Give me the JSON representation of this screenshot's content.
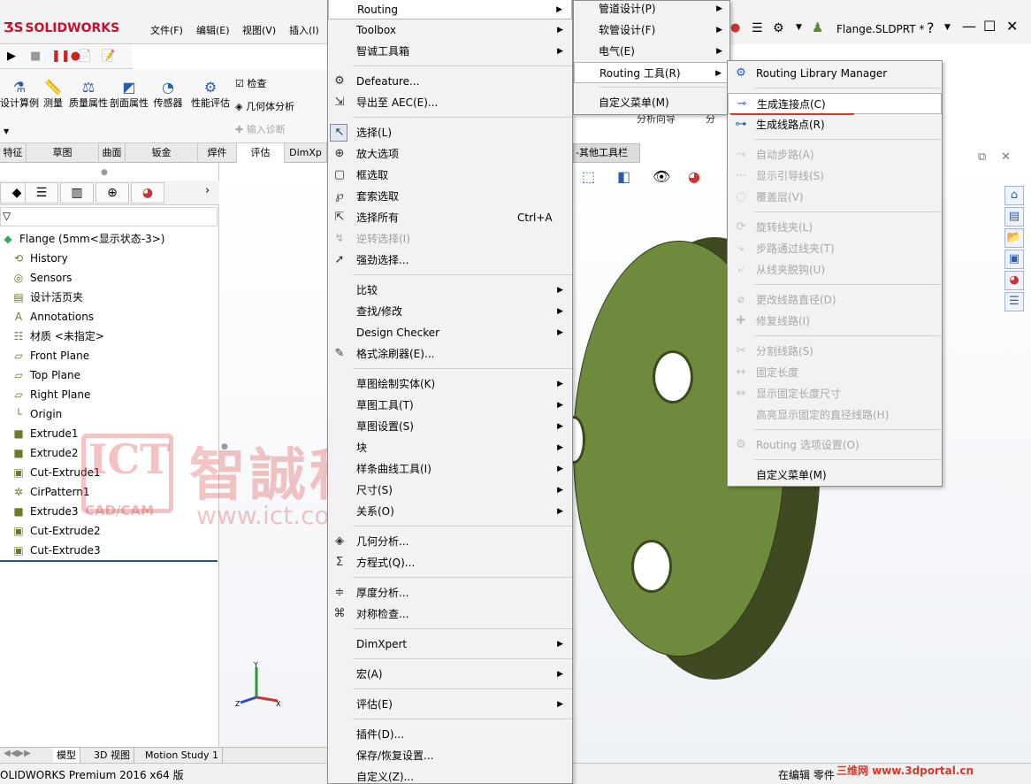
{
  "app": {
    "logo": "SOLIDWORKS",
    "menus": [
      "文件(F)",
      "编辑(E)",
      "视图(V)",
      "插入(I)"
    ],
    "doc_title": "Flange.SLDPRT *",
    "help": "?"
  },
  "command_manager": {
    "buttons": [
      "设计算例",
      "测量",
      "质量属性",
      "剖面属性",
      "传感器",
      "性能评估"
    ],
    "right_items": [
      "检查",
      "几何体分析",
      "输入诊断"
    ],
    "tabs": [
      "特征",
      "草图",
      "曲面",
      "钣金",
      "焊件",
      "评估",
      "DimXp"
    ],
    "active_tab": "评估",
    "partial_labels": [
      "分析向导",
      "分"
    ],
    "other_toolbar": "-其他工具栏"
  },
  "feature_tree": {
    "root": "Flange  (5mm<显示状态-3>)",
    "items": [
      {
        "label": "History",
        "icon": "history-icon"
      },
      {
        "label": "Sensors",
        "icon": "sensor-icon"
      },
      {
        "label": "设计活页夹",
        "icon": "binder-icon"
      },
      {
        "label": "Annotations",
        "icon": "annotation-icon"
      },
      {
        "label": "材质 <未指定>",
        "icon": "material-icon"
      },
      {
        "label": "Front Plane",
        "icon": "plane-icon"
      },
      {
        "label": "Top Plane",
        "icon": "plane-icon"
      },
      {
        "label": "Right Plane",
        "icon": "plane-icon"
      },
      {
        "label": "Origin",
        "icon": "origin-icon"
      },
      {
        "label": "Extrude1",
        "icon": "extrude-icon"
      },
      {
        "label": "Extrude2",
        "icon": "extrude-icon"
      },
      {
        "label": "Cut-Extrude1",
        "icon": "cut-icon"
      },
      {
        "label": "CirPattern1",
        "icon": "pattern-icon"
      },
      {
        "label": "Extrude3",
        "icon": "extrude-icon"
      },
      {
        "label": "Cut-Extrude2",
        "icon": "cut-icon"
      },
      {
        "label": "Cut-Extrude3",
        "icon": "cut-icon"
      }
    ]
  },
  "bottom_tabs": [
    "模型",
    "3D 视图",
    "Motion Study 1"
  ],
  "status": {
    "left": "OLIDWORKS Premium 2016 x64 版",
    "right": "在编辑 零件"
  },
  "context_menu": {
    "items": [
      {
        "label": "Routing",
        "arrow": true,
        "highlight": true
      },
      {
        "label": "Toolbox",
        "arrow": true
      },
      {
        "label": "智诚工具箱",
        "arrow": true
      },
      {
        "sep": true
      },
      {
        "label": "Defeature...",
        "icon": "defeature-icon"
      },
      {
        "label": "导出至 AEC(E)...",
        "icon": "export-icon"
      },
      {
        "sep": true
      },
      {
        "label": "选择(L)",
        "icon": "cursor-icon",
        "boxed": true
      },
      {
        "label": "放大选项",
        "icon": "magnify-icon"
      },
      {
        "label": "框选取",
        "icon": "box-select-icon"
      },
      {
        "label": "套索选取",
        "icon": "lasso-icon"
      },
      {
        "label": "选择所有",
        "icon": "select-all-icon",
        "shortcut": "Ctrl+A"
      },
      {
        "label": "逆转选择(I)",
        "icon": "invert-select-icon",
        "disabled": true
      },
      {
        "label": "强劲选择...",
        "icon": "power-select-icon"
      },
      {
        "sep": true
      },
      {
        "label": "比较",
        "arrow": true
      },
      {
        "label": "查找/修改",
        "arrow": true
      },
      {
        "label": "Design Checker",
        "arrow": true
      },
      {
        "label": "格式涂刷器(E)...",
        "icon": "format-painter-icon"
      },
      {
        "sep": true
      },
      {
        "label": "草图绘制实体(K)",
        "arrow": true
      },
      {
        "label": "草图工具(T)",
        "arrow": true
      },
      {
        "label": "草图设置(S)",
        "arrow": true
      },
      {
        "label": "块",
        "arrow": true
      },
      {
        "label": "样条曲线工具(I)",
        "arrow": true
      },
      {
        "label": "尺寸(S)",
        "arrow": true
      },
      {
        "label": "关系(O)",
        "arrow": true
      },
      {
        "sep": true
      },
      {
        "label": "几何分析...",
        "icon": "geometry-analysis-icon"
      },
      {
        "label": "方程式(Q)...",
        "icon": "sigma-icon"
      },
      {
        "sep": true
      },
      {
        "label": "厚度分析...",
        "icon": "thickness-icon"
      },
      {
        "label": "对称检查...",
        "icon": "symmetry-icon"
      },
      {
        "sep": true
      },
      {
        "label": "DimXpert",
        "arrow": true
      },
      {
        "sep": true
      },
      {
        "label": "宏(A)",
        "arrow": true
      },
      {
        "sep": true
      },
      {
        "label": "评估(E)",
        "arrow": true
      },
      {
        "sep": true
      },
      {
        "label": "插件(D)..."
      },
      {
        "label": "保存/恢复设置..."
      },
      {
        "label": "自定义(Z)..."
      }
    ]
  },
  "submenu_routing": {
    "items": [
      {
        "label": "管道设计(P)",
        "arrow": true
      },
      {
        "label": "软管设计(F)",
        "arrow": true
      },
      {
        "label": "电气(E)",
        "arrow": true
      },
      {
        "label": "Routing 工具(R)",
        "arrow": true,
        "highlight": true
      },
      {
        "sep": true
      },
      {
        "label": "自定义菜单(M)"
      }
    ]
  },
  "submenu_tools": {
    "items": [
      {
        "label": "Routing Library Manager",
        "icon": "library-icon"
      },
      {
        "sep": true
      },
      {
        "label": "生成连接点(C)",
        "icon": "connection-point-icon",
        "highlight": true
      },
      {
        "label": "生成线路点(R)",
        "icon": "route-point-icon"
      },
      {
        "sep": true
      },
      {
        "label": "自动步路(A)",
        "icon": "auto-route-icon",
        "disabled": true
      },
      {
        "label": "显示引导线(S)",
        "icon": "guideline-icon",
        "disabled": true
      },
      {
        "label": "覆盖层(V)",
        "icon": "covering-icon",
        "disabled": true
      },
      {
        "sep": true
      },
      {
        "label": "旋转线夹(L)",
        "icon": "rotate-clip-icon",
        "disabled": true
      },
      {
        "label": "步路通过线夹(T)",
        "icon": "route-clip-icon",
        "disabled": true
      },
      {
        "label": "从线夹脱钩(U)",
        "icon": "unhook-icon",
        "disabled": true
      },
      {
        "sep": true
      },
      {
        "label": "更改线路直径(D)",
        "icon": "diameter-icon",
        "disabled": true
      },
      {
        "label": "修复线路(I)",
        "icon": "repair-icon",
        "disabled": true
      },
      {
        "sep": true
      },
      {
        "label": "分割线路(S)",
        "icon": "split-icon",
        "disabled": true
      },
      {
        "label": "固定长度",
        "icon": "length-icon",
        "disabled": true
      },
      {
        "label": "显示固定长度尺寸",
        "icon": "length-dim-icon",
        "disabled": true
      },
      {
        "label": "高亮显示固定的直径线路(H)",
        "icon": "",
        "disabled": true
      },
      {
        "sep": true
      },
      {
        "label": "Routing 选项设置(O)",
        "icon": "options-icon",
        "disabled": true
      },
      {
        "sep": true
      },
      {
        "label": "自定义菜单(M)"
      }
    ]
  },
  "watermark": {
    "ict": "ICT",
    "cadcam": "CAD/CAM",
    "chinese": "智誠科技",
    "url": "www.ict.com.cn",
    "portal": "三维网 www.3dportal.cn"
  },
  "colors": {
    "part": "#6e8a3c",
    "logo": "#c8102e",
    "selection_underline": "#d23a2a"
  }
}
